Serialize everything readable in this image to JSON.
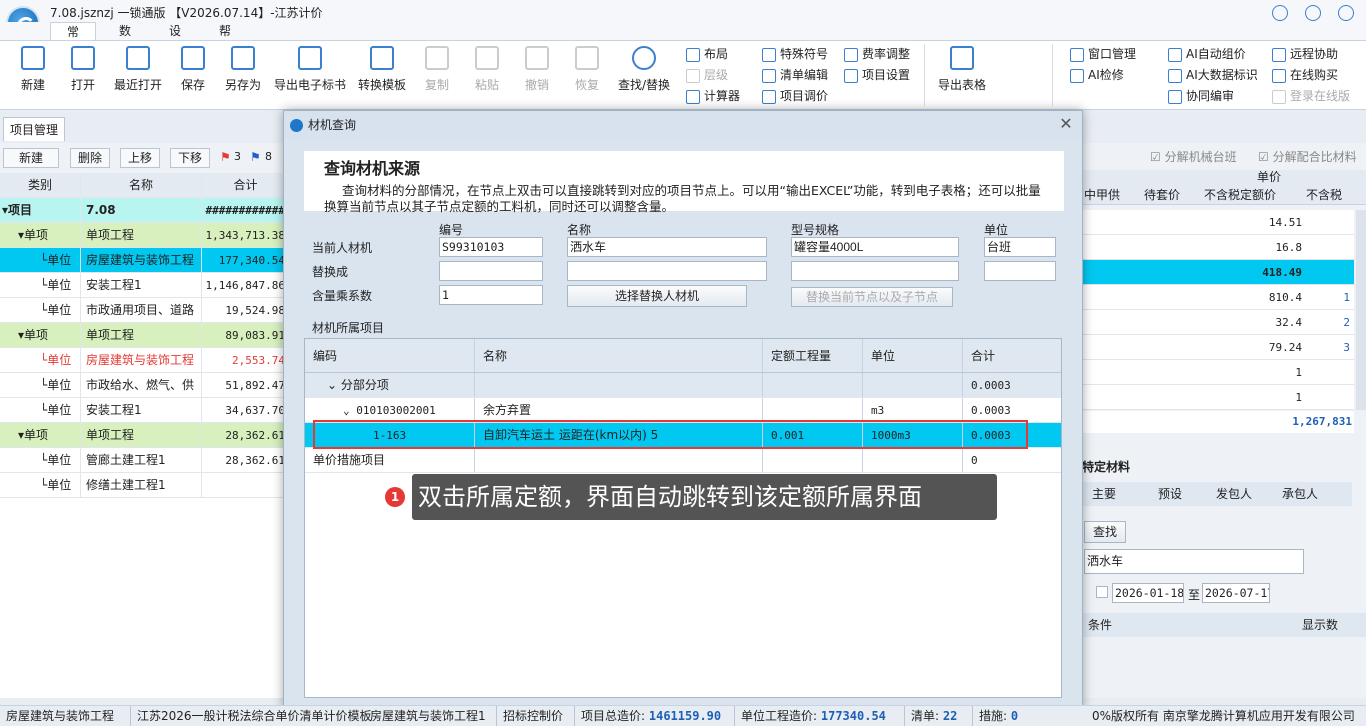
{
  "app": {
    "title": "7.08.jsznzj  一锁通版 【V2026.07.14】-江苏计价",
    "menu_tabs": [
      "常用",
      "数据",
      "设置",
      "帮助"
    ]
  },
  "ribbon": {
    "buttons": [
      {
        "label": "新建",
        "icon": "new-file-icon"
      },
      {
        "label": "打开",
        "icon": "folder-open-icon"
      },
      {
        "label": "最近打开",
        "icon": "recent-icon"
      },
      {
        "label": "保存",
        "icon": "save-icon"
      },
      {
        "label": "另存为",
        "icon": "save-as-icon"
      },
      {
        "label": "导出电子标书",
        "icon": "export-bid-icon"
      },
      {
        "label": "转换模板",
        "icon": "convert-template-icon"
      },
      {
        "label": "复制",
        "icon": "copy-icon"
      },
      {
        "label": "粘贴",
        "icon": "paste-icon"
      },
      {
        "label": "撤销",
        "icon": "undo-icon"
      },
      {
        "label": "恢复",
        "icon": "redo-icon"
      },
      {
        "label": "查找/替换",
        "icon": "search-icon"
      }
    ],
    "small_col1": [
      "布局",
      "层级",
      "计算器"
    ],
    "small_col2": [
      "特殊符号",
      "清单编辑",
      "项目调价"
    ],
    "small_col3": [
      "费率调整",
      "项目设置"
    ],
    "export_table": "导出表格",
    "small_col4": [
      "窗口管理",
      "AI检修"
    ],
    "small_col5": [
      "AI自动组价",
      "AI大数据标识",
      "协同编审"
    ],
    "small_col6": [
      "远程协助",
      "在线购买",
      "登录在线版"
    ]
  },
  "left_panel": {
    "tab": "项目管理",
    "toolbar": [
      "新建",
      "删除",
      "上移",
      "下移"
    ],
    "flag_red_count": "3",
    "flag_blue_count": "8",
    "columns": [
      "类别",
      "名称",
      "合计"
    ],
    "rows": [
      {
        "type": "项目",
        "name": "7.08",
        "total": "############",
        "style": "root"
      },
      {
        "type": "单项",
        "name": "单项工程",
        "total": "1,343,713.38",
        "style": "group"
      },
      {
        "type": "单位",
        "name": "房屋建筑与装饰工程",
        "total": "177,340.54",
        "style": "selected"
      },
      {
        "type": "单位",
        "name": "安装工程1",
        "total": "1,146,847.86",
        "style": "normal"
      },
      {
        "type": "单位",
        "name": "市政通用项目、道路",
        "total": "19,524.98",
        "style": "normal"
      },
      {
        "type": "单项",
        "name": "单项工程",
        "total": "89,083.91",
        "style": "group"
      },
      {
        "type": "单位",
        "name": "房屋建筑与装饰工程",
        "total": "2,553.74",
        "style": "red"
      },
      {
        "type": "单位",
        "name": "市政给水、燃气、供",
        "total": "51,892.47",
        "style": "normal"
      },
      {
        "type": "单位",
        "name": "安装工程1",
        "total": "34,637.70",
        "style": "normal"
      },
      {
        "type": "单项",
        "name": "单项工程",
        "total": "28,362.61",
        "style": "group"
      },
      {
        "type": "单位",
        "name": "管廊土建工程1",
        "total": "28,362.61",
        "style": "normal"
      },
      {
        "type": "单位",
        "name": "修缮土建工程1",
        "total": "",
        "style": "normal"
      }
    ]
  },
  "right_panel": {
    "checkbox1": "分解机械台班",
    "checkbox2": "分解配合比材料",
    "price_header": "单价",
    "columns": [
      "中甲供",
      "待套价",
      "不含税定额价",
      "不含税"
    ],
    "rows": [
      {
        "price": "14.51",
        "extra": ""
      },
      {
        "price": "16.8",
        "extra": ""
      },
      {
        "price": "418.49",
        "extra": ""
      },
      {
        "price": "810.4",
        "extra": "1"
      },
      {
        "price": "32.4",
        "extra": "2"
      },
      {
        "price": "79.24",
        "extra": "3"
      },
      {
        "price": "1",
        "extra": ""
      },
      {
        "price": "1",
        "extra": ""
      }
    ],
    "total": "1,267,831",
    "section_title": "特定材料",
    "tabs": [
      "主要",
      "预设",
      "发包人",
      "承包人"
    ],
    "search_button": "查找",
    "search_value": "洒水车",
    "date_from": "2026-01-18",
    "date_to_label": "至",
    "date_to": "2026-07-17",
    "cond_label": "条件",
    "display_label": "显示数"
  },
  "modal": {
    "title": "材机查询",
    "header_title": "查询材机来源",
    "header_desc": "查询材料的分部情况，在节点上双击可以直接跳转到对应的项目节点上。可以用“输出EXCEL”功能，转到电子表格；还可以批量换算当前节点以其子节点定额的工料机，同时还可以调整含量。",
    "field_headers": [
      "编号",
      "名称",
      "型号规格",
      "单位"
    ],
    "current_label": "当前人材机",
    "current": {
      "code": "S99310103",
      "name": "洒水车",
      "spec": "罐容量4000L",
      "unit": "台班"
    },
    "replace_label": "替换成",
    "ratio_label": "含量乘系数",
    "ratio_value": "1",
    "select_button": "选择替换人材机",
    "replace_button": "替换当前节点以及子节点",
    "group_label": "材机所属项目",
    "grid_columns": [
      "编码",
      "名称",
      "定额工程量",
      "单位",
      "合计"
    ],
    "grid_rows": [
      {
        "code": "分部分项",
        "name": "",
        "qty": "",
        "unit": "",
        "total": "0.0003",
        "level": 1
      },
      {
        "code": "010103002001",
        "name": "余方弃置",
        "qty": "",
        "unit": "m3",
        "total": "0.0003",
        "level": 2
      },
      {
        "code": "1-163",
        "name": "自卸汽车运土 运距在(km以内) 5",
        "qty": "0.001",
        "unit": "1000m3",
        "total": "0.0003",
        "level": 3
      },
      {
        "code": "单价措施项目",
        "name": "",
        "qty": "",
        "unit": "",
        "total": "0",
        "level": 0
      }
    ]
  },
  "tooltip": {
    "badge": "1",
    "text": "双击所属定额，界面自动跳转到该定额所属界面"
  },
  "statusbar": {
    "item1": "房屋建筑与装饰工程",
    "item2": "江苏2026一般计税法综合单价清单计价模板",
    "item3": "房屋建筑与装饰工程1",
    "item4": "招标控制价",
    "total_label": "项目总造价:",
    "total_value": "1461159.90",
    "unit_label": "单位工程造价:",
    "unit_value": "177340.54",
    "list_label": "清单:",
    "list_value": "22",
    "measure_label": "措施:",
    "measure_value": "0",
    "copyright": "0%版权所有 南京擎龙腾计算机应用开发有限公司"
  }
}
